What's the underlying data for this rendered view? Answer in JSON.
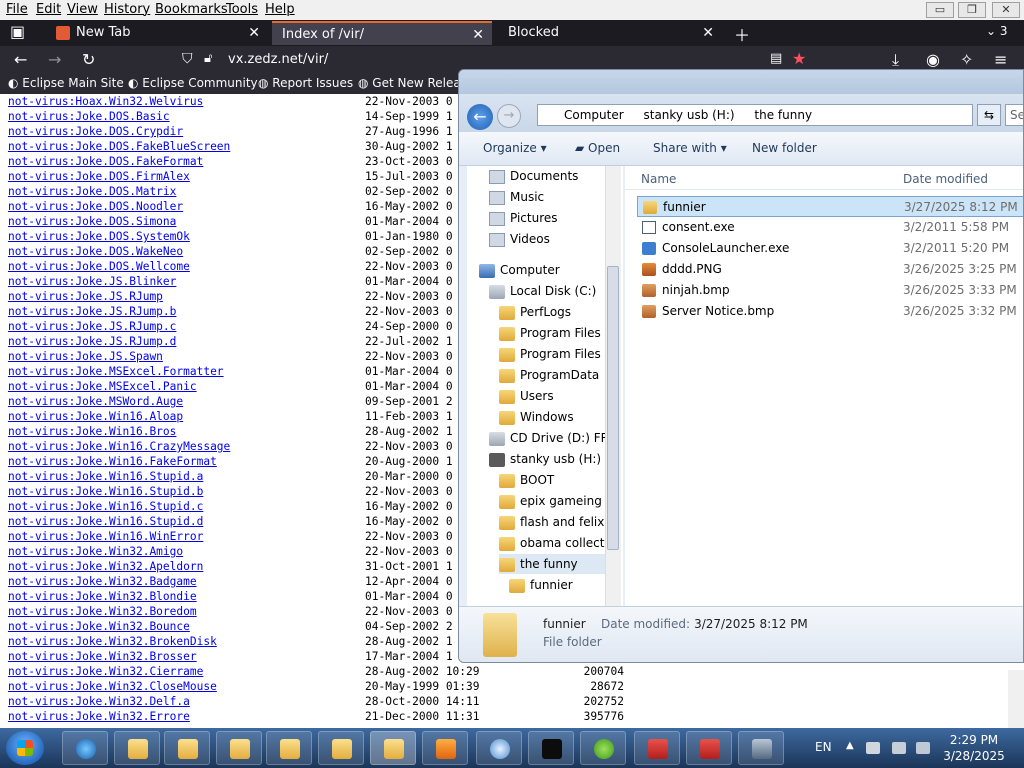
{
  "menu": [
    "File",
    "Edit",
    "View",
    "History",
    "Bookmarks",
    "Tools",
    "Help"
  ],
  "window_controls": {
    "minimize": "▭",
    "restore": "❐",
    "close": "✕"
  },
  "tabs": [
    {
      "label": "New Tab",
      "active": false
    },
    {
      "label": "Index of /vir/",
      "active": true
    },
    {
      "label": "Blocked",
      "active": false
    }
  ],
  "tab_count": "3",
  "address": {
    "url": "vx.zedz.net/vir/"
  },
  "bookmarks": [
    "Eclipse Main Site",
    "Eclipse Community",
    "Report Issues",
    "Get New Releas"
  ],
  "listing": [
    {
      "name": "not-virus:Hoax.Win32.Welvirus",
      "date": "22-Nov-2003 0",
      "size": ""
    },
    {
      "name": "not-virus:Joke.DOS.Basic",
      "date": "14-Sep-1999 1",
      "size": ""
    },
    {
      "name": "not-virus:Joke.DOS.Crypdir",
      "date": "27-Aug-1996 1",
      "size": ""
    },
    {
      "name": "not-virus:Joke.DOS.FakeBlueScreen",
      "date": "30-Aug-2002 1",
      "size": ""
    },
    {
      "name": "not-virus:Joke.DOS.FakeFormat",
      "date": "23-Oct-2003 0",
      "size": ""
    },
    {
      "name": "not-virus:Joke.DOS.FirmAlex",
      "date": "15-Jul-2003 0",
      "size": ""
    },
    {
      "name": "not-virus:Joke.DOS.Matrix",
      "date": "02-Sep-2002 0",
      "size": ""
    },
    {
      "name": "not-virus:Joke.DOS.Noodler",
      "date": "16-May-2002 0",
      "size": ""
    },
    {
      "name": "not-virus:Joke.DOS.Simona",
      "date": "01-Mar-2004 0",
      "size": ""
    },
    {
      "name": "not-virus:Joke.DOS.SystemOk",
      "date": "01-Jan-1980 0",
      "size": ""
    },
    {
      "name": "not-virus:Joke.DOS.WakeNeo",
      "date": "02-Sep-2002 0",
      "size": ""
    },
    {
      "name": "not-virus:Joke.DOS.Wellcome",
      "date": "22-Nov-2003 0",
      "size": ""
    },
    {
      "name": "not-virus:Joke.JS.Blinker",
      "date": "01-Mar-2004 0",
      "size": ""
    },
    {
      "name": "not-virus:Joke.JS.RJump",
      "date": "22-Nov-2003 0",
      "size": ""
    },
    {
      "name": "not-virus:Joke.JS.RJump.b",
      "date": "22-Nov-2003 0",
      "size": ""
    },
    {
      "name": "not-virus:Joke.JS.RJump.c",
      "date": "24-Sep-2000 0",
      "size": ""
    },
    {
      "name": "not-virus:Joke.JS.RJump.d",
      "date": "22-Jul-2002 1",
      "size": ""
    },
    {
      "name": "not-virus:Joke.JS.Spawn",
      "date": "22-Nov-2003 0",
      "size": ""
    },
    {
      "name": "not-virus:Joke.MSExcel.Formatter",
      "date": "01-Mar-2004 0",
      "size": ""
    },
    {
      "name": "not-virus:Joke.MSExcel.Panic",
      "date": "01-Mar-2004 0",
      "size": ""
    },
    {
      "name": "not-virus:Joke.MSWord.Auge",
      "date": "09-Sep-2001 2",
      "size": ""
    },
    {
      "name": "not-virus:Joke.Win16.Aloap",
      "date": "11-Feb-2003 1",
      "size": ""
    },
    {
      "name": "not-virus:Joke.Win16.Bros",
      "date": "28-Aug-2002 1",
      "size": ""
    },
    {
      "name": "not-virus:Joke.Win16.CrazyMessage",
      "date": "22-Nov-2003 0",
      "size": ""
    },
    {
      "name": "not-virus:Joke.Win16.FakeFormat",
      "date": "20-Aug-2000 1",
      "size": ""
    },
    {
      "name": "not-virus:Joke.Win16.Stupid.a",
      "date": "20-Mar-2000 0",
      "size": ""
    },
    {
      "name": "not-virus:Joke.Win16.Stupid.b",
      "date": "22-Nov-2003 0",
      "size": ""
    },
    {
      "name": "not-virus:Joke.Win16.Stupid.c",
      "date": "16-May-2002 0",
      "size": ""
    },
    {
      "name": "not-virus:Joke.Win16.Stupid.d",
      "date": "16-May-2002 0",
      "size": ""
    },
    {
      "name": "not-virus:Joke.Win16.WinError",
      "date": "22-Nov-2003 0",
      "size": ""
    },
    {
      "name": "not-virus:Joke.Win32.Amigo",
      "date": "22-Nov-2003 0",
      "size": ""
    },
    {
      "name": "not-virus:Joke.Win32.Apeldorn",
      "date": "31-Oct-2001 1",
      "size": ""
    },
    {
      "name": "not-virus:Joke.Win32.Badgame",
      "date": "12-Apr-2004 0",
      "size": ""
    },
    {
      "name": "not-virus:Joke.Win32.Blondie",
      "date": "01-Mar-2004 0",
      "size": ""
    },
    {
      "name": "not-virus:Joke.Win32.Boredom",
      "date": "22-Nov-2003 0",
      "size": ""
    },
    {
      "name": "not-virus:Joke.Win32.Bounce",
      "date": "04-Sep-2002 2",
      "size": ""
    },
    {
      "name": "not-virus:Joke.Win32.BrokenDisk",
      "date": "28-Aug-2002 1",
      "size": ""
    },
    {
      "name": "not-virus:Joke.Win32.Brosser",
      "date": "17-Mar-2004 1",
      "size": ""
    },
    {
      "name": "not-virus:Joke.Win32.Cierrame",
      "date": "28-Aug-2002 10:29",
      "size": "200704"
    },
    {
      "name": "not-virus:Joke.Win32.CloseMouse",
      "date": "20-May-1999 01:39",
      "size": "28672"
    },
    {
      "name": "not-virus:Joke.Win32.Delf.a",
      "date": "28-Oct-2000 14:11",
      "size": "202752"
    },
    {
      "name": "not-virus:Joke.Win32.Errore",
      "date": "21-Dec-2000 11:31",
      "size": "395776"
    }
  ],
  "explorer": {
    "path": [
      "Computer",
      "stanky usb (H:)",
      "the funny"
    ],
    "search": "Se",
    "toolbar": {
      "organize": "Organize",
      "open": "Open",
      "share": "Share with",
      "new_folder": "New folder"
    },
    "nav": [
      {
        "label": "Documents",
        "kind": "lib",
        "indent": 1
      },
      {
        "label": "Music",
        "kind": "lib",
        "indent": 1
      },
      {
        "label": "Pictures",
        "kind": "lib",
        "indent": 1
      },
      {
        "label": "Videos",
        "kind": "lib",
        "indent": 1
      },
      {
        "label": "Computer",
        "kind": "comp",
        "indent": 0
      },
      {
        "label": "Local Disk (C:)",
        "kind": "disk",
        "indent": 1
      },
      {
        "label": "PerfLogs",
        "kind": "folder",
        "indent": 2
      },
      {
        "label": "Program Files",
        "kind": "folder",
        "indent": 2
      },
      {
        "label": "Program Files (",
        "kind": "folder",
        "indent": 2
      },
      {
        "label": "ProgramData",
        "kind": "folder",
        "indent": 2
      },
      {
        "label": "Users",
        "kind": "folder",
        "indent": 2
      },
      {
        "label": "Windows",
        "kind": "folder",
        "indent": 2
      },
      {
        "label": "CD Drive (D:) FRT",
        "kind": "disk",
        "indent": 1
      },
      {
        "label": "stanky usb (H:)",
        "kind": "usb",
        "indent": 1
      },
      {
        "label": "BOOT",
        "kind": "folder",
        "indent": 2
      },
      {
        "label": "epix gameing",
        "kind": "folder",
        "indent": 2
      },
      {
        "label": "flash and felix",
        "kind": "folder",
        "indent": 2
      },
      {
        "label": "obama collecti",
        "kind": "folder",
        "indent": 2
      },
      {
        "label": "the funny",
        "kind": "folder",
        "indent": 2,
        "selected": true
      },
      {
        "label": "funnier",
        "kind": "folder",
        "indent": 3
      }
    ],
    "columns": {
      "name": "Name",
      "date": "Date modified"
    },
    "files": [
      {
        "name": "funnier",
        "date": "3/27/2025 8:12 PM",
        "kind": "folder",
        "selected": true
      },
      {
        "name": "consent.exe",
        "date": "3/2/2011 5:58 PM",
        "kind": "exe"
      },
      {
        "name": "ConsoleLauncher.exe",
        "date": "3/2/2011 5:20 PM",
        "kind": "cl"
      },
      {
        "name": "dddd.PNG",
        "date": "3/26/2025 3:25 PM",
        "kind": "img"
      },
      {
        "name": "ninjah.bmp",
        "date": "3/26/2025 3:33 PM",
        "kind": "bmp"
      },
      {
        "name": "Server Notice.bmp",
        "date": "3/26/2025 3:32 PM",
        "kind": "bmp"
      }
    ],
    "details": {
      "name": "funnier",
      "type": "File folder",
      "modified_label": "Date modified:",
      "modified_value": "3/27/2025 8:12 PM"
    }
  },
  "tray": {
    "lang": "EN",
    "time": "2:29 PM",
    "date": "3/28/2025"
  }
}
